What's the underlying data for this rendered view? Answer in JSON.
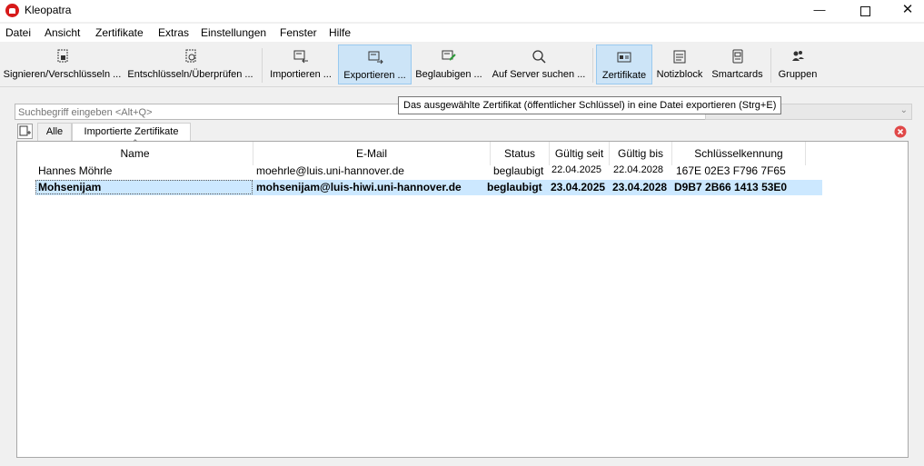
{
  "window": {
    "title": "Kleopatra",
    "minimize": "—",
    "close": "✕"
  },
  "menubar": [
    "Datei",
    "Ansicht",
    "Zertifikate",
    "Extras",
    "Einstellungen",
    "Fenster",
    "Hilfe"
  ],
  "toolbar": {
    "sign_encrypt": "Signieren/Verschlüsseln ...",
    "decrypt_verify": "Entschlüsseln/Überprüfen ...",
    "import": "Importieren ...",
    "export": "Exportieren ...",
    "certify": "Beglaubigen ...",
    "lookup_server": "Auf Server suchen ...",
    "certificates": "Zertifikate",
    "notepad": "Notizblock",
    "smartcards": "Smartcards",
    "groups": "Gruppen"
  },
  "tooltip": "Das ausgewählte Zertifikat (öffentlicher Schlüssel) in eine Datei exportieren (Strg+E)",
  "search": {
    "placeholder": "Suchbegriff eingeben <Alt+Q>"
  },
  "tabs": {
    "all": "Alle",
    "imported": "Importierte Zertifikate"
  },
  "table": {
    "headers": [
      "Name",
      "E-Mail",
      "Status",
      "Gültig seit",
      "Gültig bis",
      "Schlüsselkennung"
    ],
    "rows": [
      {
        "name": "Hannes Möhrle",
        "email": "moehrle@luis.uni-hannover.de",
        "status": "beglaubigt",
        "valid_from": "22.04.2025",
        "valid_until": "22.04.2028",
        "key_id": "167E 02E3 F796 7F65"
      },
      {
        "name": "Mohsenijam",
        "email": "mohsenijam@luis-hiwi.uni-hannover.de",
        "status": "beglaubigt",
        "valid_from": "23.04.2025",
        "valid_until": "23.04.2028",
        "key_id": "D9B7 2B66 1413 53E0"
      }
    ]
  },
  "colors": {
    "selection": "#cce8ff",
    "active_tool": "#cce4f7",
    "brand": "#d71a1a",
    "close_red": "#e04848"
  }
}
